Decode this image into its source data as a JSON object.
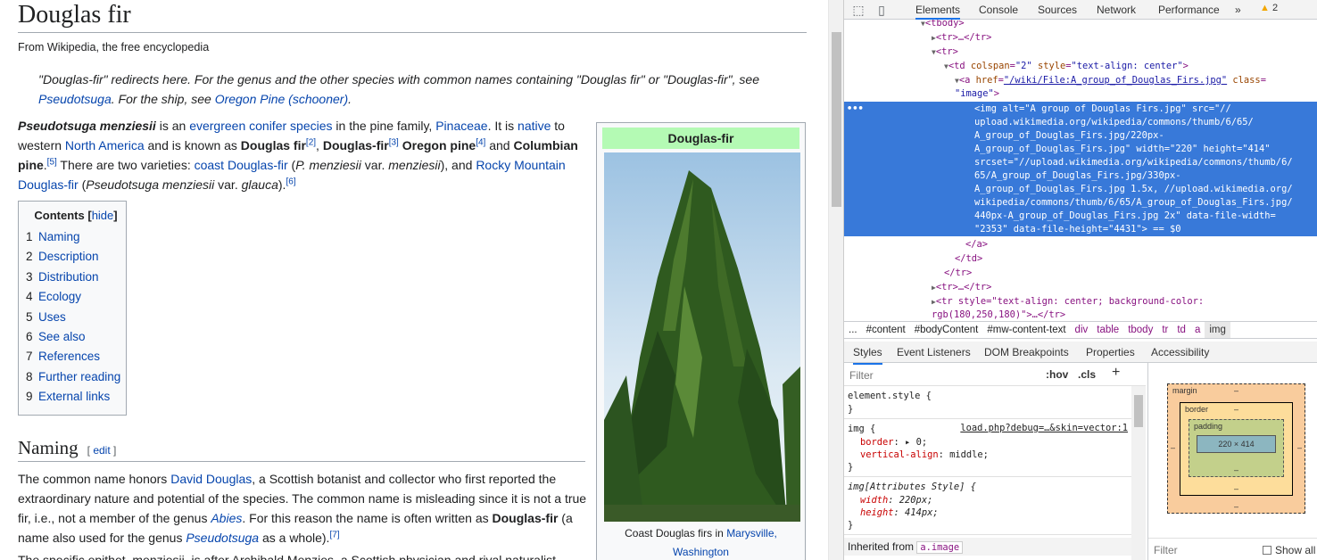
{
  "wiki": {
    "title": "Douglas fir",
    "site_sub": "From Wikipedia, the free encyclopedia",
    "hatnote": {
      "t1": "\"Douglas-fir\" redirects here. For the genus and the other species with common names containing \"Douglas fir\" or \"Douglas-fir\", see ",
      "link1": "Pseudotsuga",
      "t2": ". For the ship, see ",
      "link2": "Oregon Pine (schooner)",
      "t3": "."
    },
    "lead": {
      "b1": "Pseudotsuga menziesii",
      "t1": " is an ",
      "l1": "evergreen",
      "t2": " ",
      "l2": "conifer",
      "t3": " ",
      "l3": "species",
      "t4": " in the pine family, ",
      "l4": "Pinaceae",
      "t5": ". It is ",
      "l5": "native",
      "t6": " to western ",
      "l6": "North America",
      "t7": " and is known as ",
      "b2": "Douglas fir",
      "r2": "[2]",
      "t8": ", ",
      "b3": "Douglas-fir",
      "r3": "[3]",
      "t9": " ",
      "b4": "Oregon pine",
      "r4": "[4]",
      "t10": " and ",
      "b5": "Columbian pine",
      "r5": "[5]",
      "t11": " There are two varieties: ",
      "l7": "coast Douglas-fir",
      "t12": " (",
      "i1": "P. menziesii",
      "t13": " var. ",
      "i2": "menziesii",
      "t14": "), and ",
      "l8": "Rocky Mountain Douglas-fir",
      "t15": " (",
      "i3": "Pseudotsuga menziesii",
      "t16": " var. ",
      "i4": "glauca",
      "t17": ").",
      "r6": "[6]"
    },
    "toc": {
      "title": "Contents",
      "hide": "hide",
      "items": [
        {
          "num": "1",
          "label": "Naming"
        },
        {
          "num": "2",
          "label": "Description"
        },
        {
          "num": "3",
          "label": "Distribution"
        },
        {
          "num": "4",
          "label": "Ecology"
        },
        {
          "num": "5",
          "label": "Uses"
        },
        {
          "num": "6",
          "label": "See also"
        },
        {
          "num": "7",
          "label": "References"
        },
        {
          "num": "8",
          "label": "Further reading"
        },
        {
          "num": "9",
          "label": "External links"
        }
      ]
    },
    "naming": {
      "heading": "Naming",
      "edit": "edit",
      "t1": "The common name honors ",
      "l1": "David Douglas",
      "t2": ", a Scottish botanist and collector who first reported the extraordinary nature and potential of the species. The common name is misleading since it is not a true fir, i.e., not a member of the genus ",
      "i1": "Abies",
      "t3": ". For this reason the name is often written as ",
      "b1": "Douglas-fir",
      "t4": " (a name also used for the genus ",
      "i2": "Pseudotsuga",
      "t5": " as a whole).",
      "r1": "[7]",
      "p2": "The specific epithet, menziesii, is after Archibald Menzies, a Scottish physician and rival naturalist"
    },
    "infobox": {
      "title": "Douglas-fir",
      "caption_t1": "Coast Douglas firs in ",
      "caption_l1": "Marysville, Washington"
    }
  },
  "devtools": {
    "tabs": [
      "Elements",
      "Console",
      "Sources",
      "Network",
      "Performance"
    ],
    "more": "»",
    "warnings": "2",
    "dom": {
      "l0": "tbody",
      "l1": "<tr>…</tr>",
      "l2": "<tr>",
      "l3_a": "td",
      "l3_b": " colspan",
      "l3_c": "\"2\"",
      "l3_d": " style",
      "l3_e": "\"text-align: center\"",
      "l4_a": "a",
      "l4_b": " href",
      "l4_c": "\"/wiki/File:A_group_of_Douglas_Firs.jpg\"",
      "l4_d": " class",
      "l5": "\"image\"",
      "sel": [
        "<img alt=\"A group of Douglas Firs.jpg\" src=\"//",
        "upload.wikimedia.org/wikipedia/commons/thumb/6/65/",
        "A_group_of_Douglas_Firs.jpg/220px-",
        "A_group_of_Douglas_Firs.jpg\" width=\"220\" height=\"414\"",
        "srcset=\"//upload.wikimedia.org/wikipedia/commons/thumb/6/",
        "65/A_group_of_Douglas_Firs.jpg/330px-",
        "A_group_of_Douglas_Firs.jpg 1.5x, //upload.wikimedia.org/",
        "wikipedia/commons/thumb/6/65/A_group_of_Douglas_Firs.jpg/",
        "440px-A_group_of_Douglas_Firs.jpg 2x\" data-file-width=",
        "\"2353\" data-file-height=\"4431\"> == $0"
      ],
      "l_a_close": "</a>",
      "l_td_close": "</td>",
      "l_tr_close": "</tr>",
      "l_tr2": "<tr>…</tr>",
      "l_tr3": "<tr style=\"text-align: center; background-color:",
      "l_tr3b": "rgb(180,250,180)\">…</tr>"
    },
    "crumbs": [
      "...",
      "#content",
      "#bodyContent",
      "#mw-content-text",
      "div",
      "table",
      "tbody",
      "tr",
      "td",
      "a",
      "img"
    ],
    "subtabs": [
      "Styles",
      "Event Listeners",
      "DOM Breakpoints",
      "Properties",
      "Accessibility"
    ],
    "styles": {
      "filter_placeholder": "Filter",
      "hov": ":hov",
      "cls": ".cls",
      "plus": "+",
      "r1_sel": "element.style {",
      "r1_close": "}",
      "r2_sel": "img {",
      "r2_src": "load.php?debug=…&skin=vector:1",
      "r2_p1": "border",
      "r2_v1": ": ▸ 0;",
      "r2_p2": "vertical-align",
      "r2_v2": ": middle;",
      "r2_close": "}",
      "r3_sel": "img[Attributes Style] {",
      "r3_p1": "width",
      "r3_v1": ": 220px;",
      "r3_p2": "height",
      "r3_v2": ": 414px;",
      "r3_close": "}",
      "inherited": "Inherited from ",
      "inherited_ref": "a.image"
    },
    "boxmodel": {
      "margin": "margin",
      "border": "border",
      "padding": "padding",
      "dash": "–",
      "content": "220 × 414",
      "filter_placeholder": "Filter",
      "show_all": "Show all"
    }
  }
}
